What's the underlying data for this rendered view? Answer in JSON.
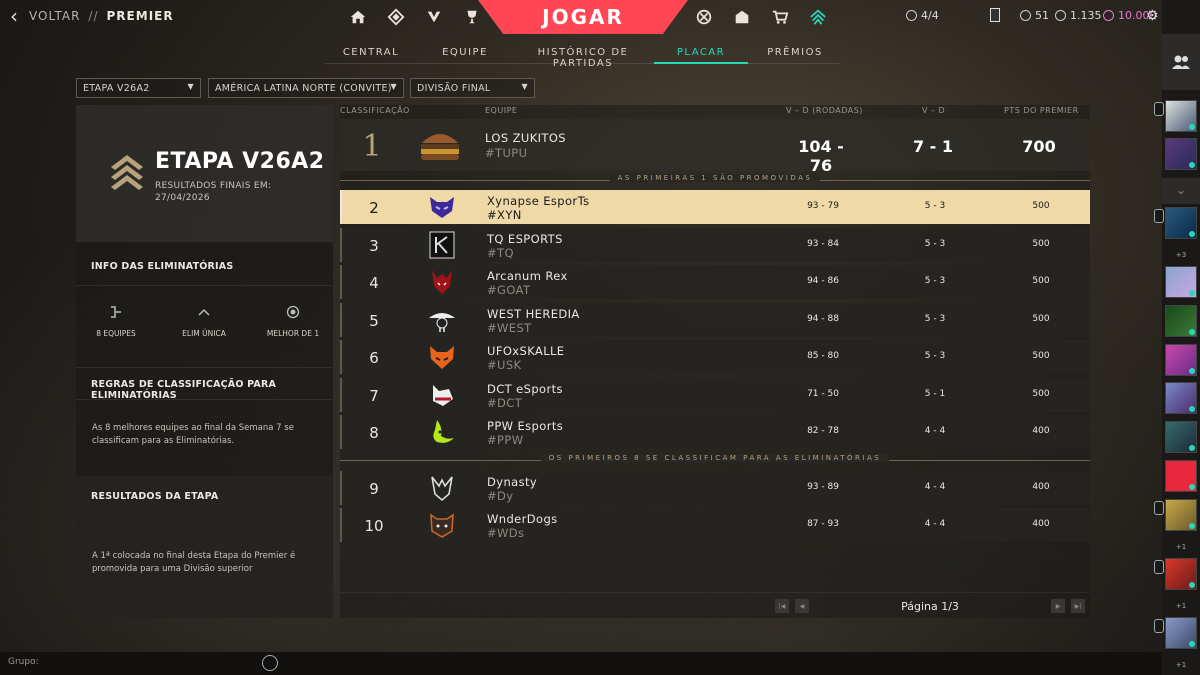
{
  "topbar": {
    "back_label": "VOLTAR",
    "separator": "//",
    "section": "PREMIER",
    "play_label": "JOGAR",
    "nav_left_icons": [
      "home-icon",
      "career-icon",
      "agents-icon",
      "trophy-icon"
    ],
    "nav_right_icons": [
      "battlepass-icon",
      "collection-icon",
      "store-icon",
      "premier-icon"
    ],
    "party_count": "4/4",
    "radianite": "51",
    "vp": "1.135",
    "kingdom_credits": "10.000",
    "accent": "#ff4655"
  },
  "tabs": [
    {
      "label": "CENTRAL",
      "active": false
    },
    {
      "label": "EQUIPE",
      "active": false
    },
    {
      "label": "HISTÓRICO DE PARTIDAS",
      "active": false
    },
    {
      "label": "PLACAR",
      "active": true
    },
    {
      "label": "PRÊMIOS",
      "active": false
    }
  ],
  "filters": {
    "stage": "ETAPA V26A2",
    "region": "AMÉRICA LATINA NORTE (CONVITE)",
    "division": "DIVISÃO FINAL"
  },
  "stage_panel": {
    "title": "ETAPA V26A2",
    "results_label": "RESULTADOS FINAIS EM:",
    "results_date": "27/04/2026",
    "playoffs_info_title": "INFO DAS ELIMINATÓRIAS",
    "teams": "8 EQUIPES",
    "format": "ELIM ÚNICA",
    "best_of": "MELHOR DE 1",
    "rules_title": "REGRAS DE CLASSIFICAÇÃO PARA ELIMINATÓRIAS",
    "rules_text": "As 8 melhores equipes ao final da Semana 7 se classificam para as Eliminatórias.",
    "results_title": "RESULTADOS DA ETAPA",
    "results_text": "A 1ª colocada no final desta Etapa do Premier é promovida para uma Divisão superior"
  },
  "table": {
    "headers": {
      "rank": "CLASSIFICAÇÃO",
      "team": "EQUIPE",
      "rounds": "V – D (RODADAS)",
      "wl": "V – D",
      "points": "PTS DO PREMIER"
    },
    "rows": [
      {
        "rank": "1",
        "name": "LOS ZUKITOS",
        "tag": "#TUPU",
        "rounds": "104 - 76",
        "wl": "7 - 1",
        "points": "700"
      },
      {
        "rank": "2",
        "name": "Xynapse EsporTs",
        "tag": "#XYN",
        "rounds": "93 - 79",
        "wl": "5 - 3",
        "points": "500"
      },
      {
        "rank": "3",
        "name": "TQ ESPORTS",
        "tag": "#TQ",
        "rounds": "93 - 84",
        "wl": "5 - 3",
        "points": "500"
      },
      {
        "rank": "4",
        "name": "Arcanum Rex",
        "tag": "#GOAT",
        "rounds": "94 - 86",
        "wl": "5 - 3",
        "points": "500"
      },
      {
        "rank": "5",
        "name": "WEST HEREDIA",
        "tag": "#WEST",
        "rounds": "94 - 88",
        "wl": "5 - 3",
        "points": "500"
      },
      {
        "rank": "6",
        "name": "UFOxSKALLE",
        "tag": "#USK",
        "rounds": "85 - 80",
        "wl": "5 - 3",
        "points": "500"
      },
      {
        "rank": "7",
        "name": "DCT eSports",
        "tag": "#DCT",
        "rounds": "71 - 50",
        "wl": "5 - 1",
        "points": "500"
      },
      {
        "rank": "8",
        "name": "PPW Esports",
        "tag": "#PPW",
        "rounds": "82 - 78",
        "wl": "4 - 4",
        "points": "400"
      },
      {
        "rank": "9",
        "name": "Dynasty",
        "tag": "#Dy",
        "rounds": "93 - 89",
        "wl": "4 - 4",
        "points": "400"
      },
      {
        "rank": "10",
        "name": "WnderDogs",
        "tag": "#WDs",
        "rounds": "87 - 93",
        "wl": "4 - 4",
        "points": "400"
      }
    ],
    "promotion_divider": "AS PRIMEIRAS 1 SÃO PROMOVIDAS",
    "playoff_divider": "OS PRIMEIROS 8 SE CLASSIFICAM PARA AS ELIMINATÓRIAS",
    "page": "Página 1/3"
  },
  "friends": {
    "plus_labels": [
      "+3",
      "+1",
      "+1",
      "+1"
    ]
  },
  "bottom": {
    "group_label": "Grupo:"
  }
}
